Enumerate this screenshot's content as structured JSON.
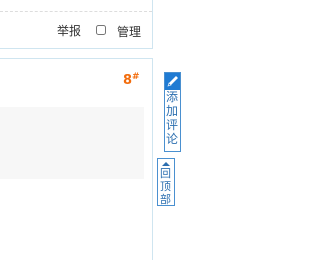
{
  "post_actions": {
    "report_label": "举报",
    "manage_label": "管理"
  },
  "post": {
    "floor_number": "8",
    "floor_suffix": "#"
  },
  "sidebar": {
    "add_comment_label": "添加评论",
    "back_to_top_label": "回顶部"
  },
  "colors": {
    "accent": "#1f7bd3",
    "floor_number": "#f26c0c",
    "border": "#cfe5f0"
  },
  "icons": {
    "add_comment": "pencil-icon",
    "back_to_top": "up-arrow-icon"
  }
}
